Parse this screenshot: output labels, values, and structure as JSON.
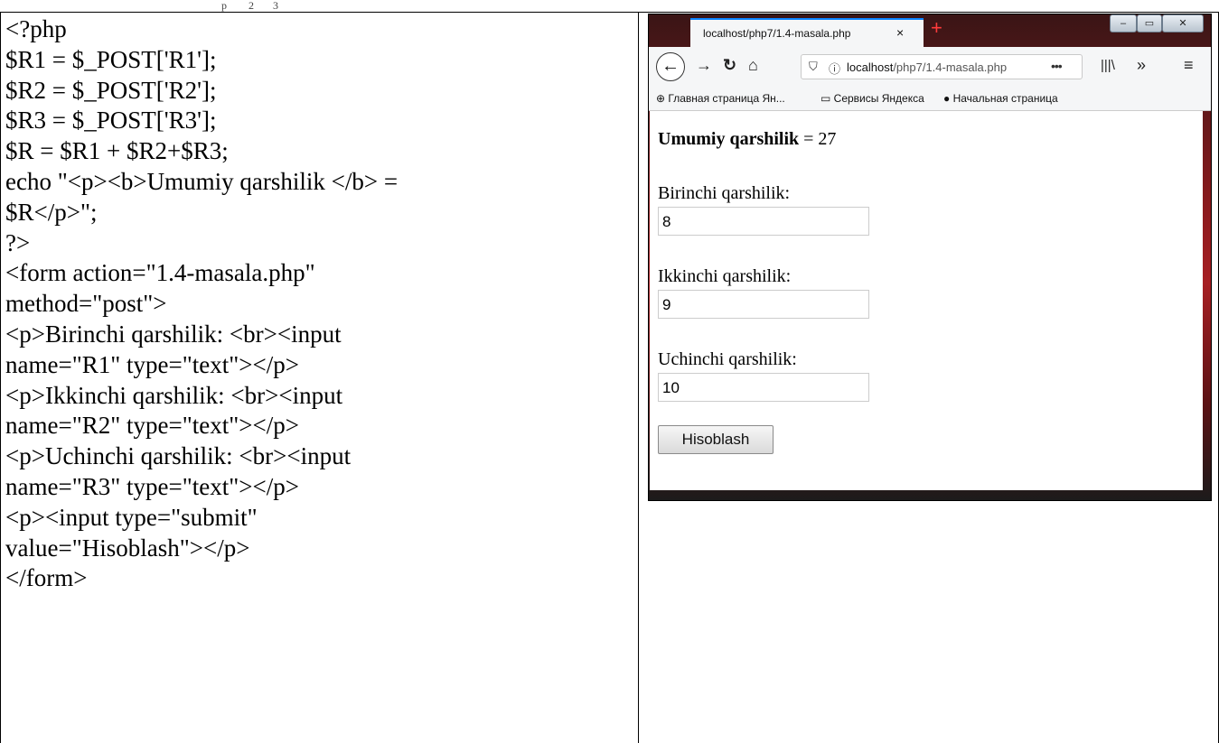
{
  "header_fragment": "p        2       3",
  "code": {
    "lines": [
      "<?php",
      "$R1 = $_POST['R1'];",
      "$R2 = $_POST['R2'];",
      "$R3 = $_POST['R3'];",
      "$R = $R1 + $R2+$R3;",
      "echo \"<p><b>Umumiy qarshilik </b> =",
      "$R</p>\";",
      "?>",
      "<form action=\"1.4-masala.php\"",
      "method=\"post\">",
      "<p>Birinchi qarshilik: <br><input",
      "name=\"R1\" type=\"text\"></p>",
      "<p>Ikkinchi qarshilik: <br><input",
      "name=\"R2\" type=\"text\"></p>",
      "<p>Uchinchi qarshilik: <br><input",
      "name=\"R3\" type=\"text\"></p>",
      "<p><input type=\"submit\"",
      "value=\"Hisoblash\"></p>",
      "</form>"
    ]
  },
  "browser": {
    "tab_title": "localhost/php7/1.4-masala.php",
    "tab_close": "×",
    "new_tab": "+",
    "url_host": "localhost",
    "url_path": "/php7/1.4-masala.php",
    "url_more": "•••",
    "bookmarks": [
      "Главная страница Ян...",
      "Сервисы Яндекса",
      "Начальная страница"
    ]
  },
  "page": {
    "result_bold": "Umumiy qarshilik",
    "result_rest": " = 27",
    "fields": [
      {
        "label": "Birinchi qarshilik:",
        "value": "8"
      },
      {
        "label": "Ikkinchi qarshilik:",
        "value": "9"
      },
      {
        "label": "Uchinchi qarshilik:",
        "value": "10"
      }
    ],
    "submit_label": "Hisoblash"
  }
}
